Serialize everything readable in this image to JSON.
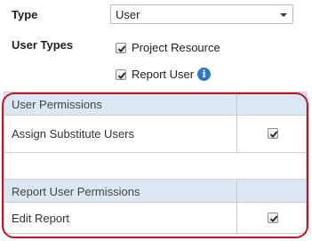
{
  "form": {
    "type_label": "Type",
    "type_value": "User",
    "user_types_label": "User Types",
    "user_types": [
      {
        "label": "Project Resource",
        "checked": true
      },
      {
        "label": "Report User",
        "checked": true
      }
    ],
    "info_icon": "info-icon"
  },
  "permissions": {
    "sections": [
      {
        "header": "User Permissions",
        "rows": [
          {
            "label": "Assign Substitute Users",
            "checked": true
          }
        ]
      },
      {
        "header": "Report User Permissions",
        "rows": [
          {
            "label": "Edit Report",
            "checked": true
          }
        ]
      }
    ]
  },
  "colors": {
    "header_bg": "#dbe7f3",
    "highlight_border": "#c0182a",
    "info_blue": "#2e78c6"
  }
}
